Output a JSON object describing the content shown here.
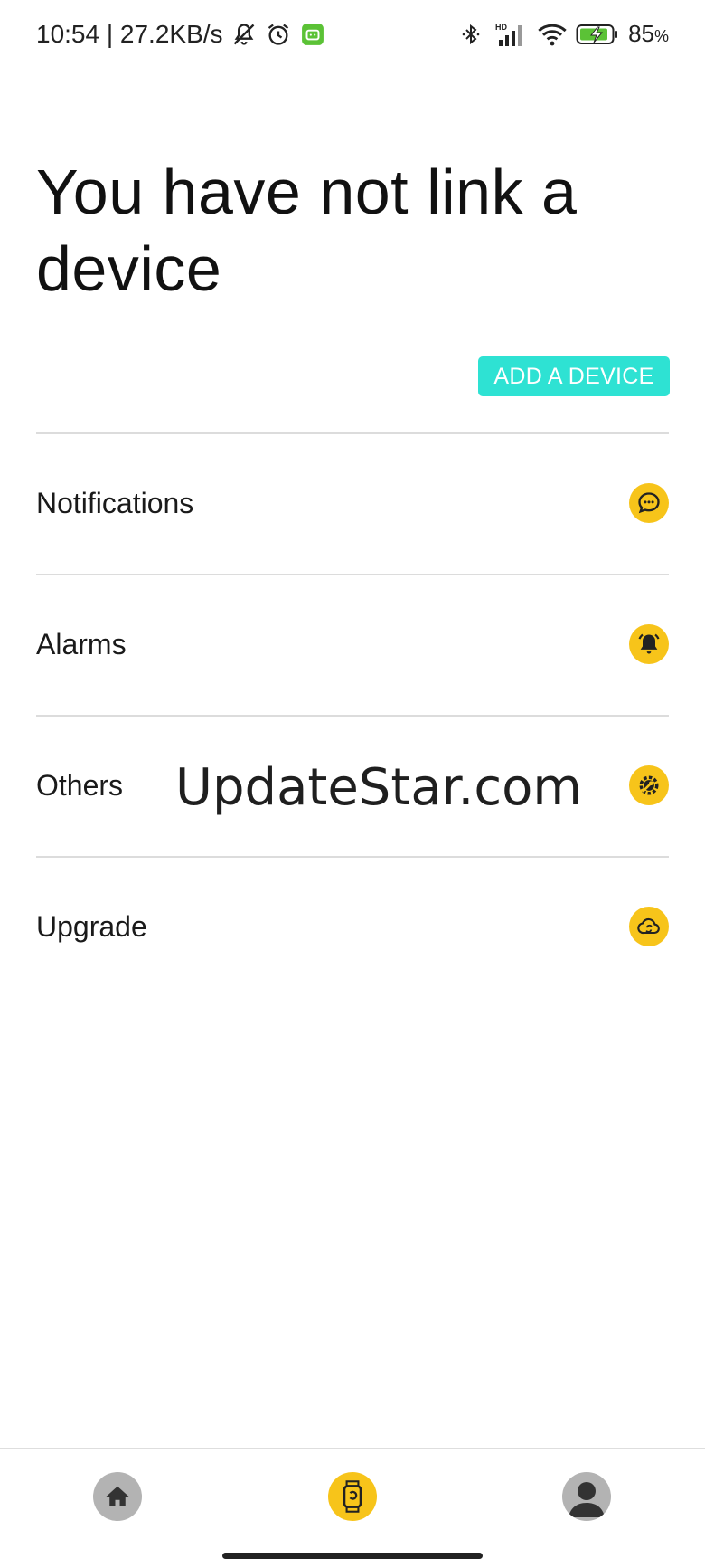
{
  "status_bar": {
    "time_speed": "10:54 | 27.2KB/s",
    "network": "HD",
    "battery": "85",
    "battery_unit": "%",
    "icons": [
      "mute-bell-icon",
      "alarm-clock-icon",
      "app-notification-icon",
      "bluetooth-icon",
      "signal-icon",
      "wifi-icon",
      "battery-icon"
    ]
  },
  "page": {
    "title": "You have not link a device",
    "add_button": "ADD A DEVICE"
  },
  "settings": {
    "items": [
      {
        "label": "Notifications",
        "icon": "message-icon"
      },
      {
        "label": "Alarms",
        "icon": "bell-icon"
      },
      {
        "label": "Others",
        "icon": "wrench-gear-icon"
      },
      {
        "label": "Upgrade",
        "icon": "cloud-sync-icon"
      }
    ]
  },
  "watermark": "UpdateStar.com",
  "bottom_nav": {
    "items": [
      {
        "icon": "home-icon",
        "active": false
      },
      {
        "icon": "watch-icon",
        "active": true
      },
      {
        "icon": "profile-icon",
        "active": false
      }
    ]
  },
  "colors": {
    "accent": "#2ee2d3",
    "icon_bg": "#f7c41a",
    "nav_inactive": "#b3b3b3"
  }
}
